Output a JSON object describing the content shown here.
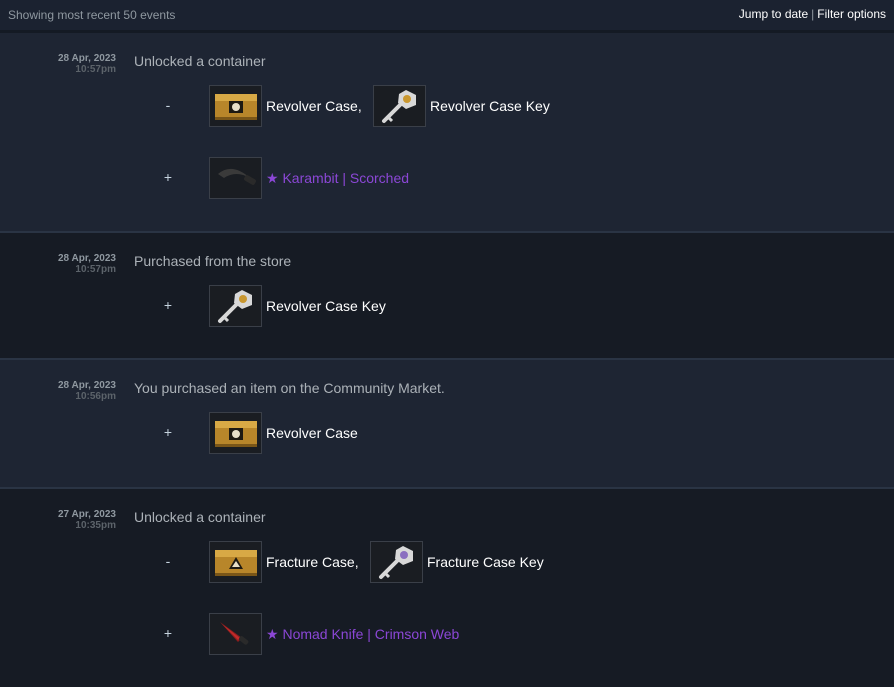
{
  "header": {
    "showing": "Showing most recent 50 events",
    "jump": "Jump to date",
    "separator": "|",
    "filter": "Filter options"
  },
  "events": [
    {
      "date": "28 Apr, 2023",
      "time": "10:57pm",
      "description": "Unlocked a container",
      "minus_sign": "-",
      "plus_sign": "+",
      "minus_items": [
        {
          "name": "Revolver Case,",
          "icon": "case-icon"
        },
        {
          "name": "Revolver Case Key",
          "icon": "key-icon"
        }
      ],
      "plus_items": [
        {
          "star": "★",
          "name": "Karambit | Scorched",
          "icon": "knife-icon"
        }
      ]
    },
    {
      "date": "28 Apr, 2023",
      "time": "10:57pm",
      "description": "Purchased from the store",
      "plus_sign": "+",
      "plus_items": [
        {
          "name": "Revolver Case Key",
          "icon": "key-icon"
        }
      ]
    },
    {
      "date": "28 Apr, 2023",
      "time": "10:56pm",
      "description": "You purchased an item on the Community Market.",
      "plus_sign": "+",
      "plus_items": [
        {
          "name": "Revolver Case",
          "icon": "case-icon"
        }
      ]
    },
    {
      "date": "27 Apr, 2023",
      "time": "10:35pm",
      "description": "Unlocked a container",
      "minus_sign": "-",
      "plus_sign": "+",
      "minus_items": [
        {
          "name": "Fracture Case,",
          "icon": "case-icon"
        },
        {
          "name": "Fracture Case Key",
          "icon": "key-icon"
        }
      ],
      "plus_items": [
        {
          "star": "★",
          "name": "Nomad Knife | Crimson Web",
          "icon": "knife-icon"
        }
      ]
    }
  ],
  "colors": {
    "knife_name": "#8b47d6",
    "case_gold": "#c9972f",
    "background": "#1b2230"
  }
}
